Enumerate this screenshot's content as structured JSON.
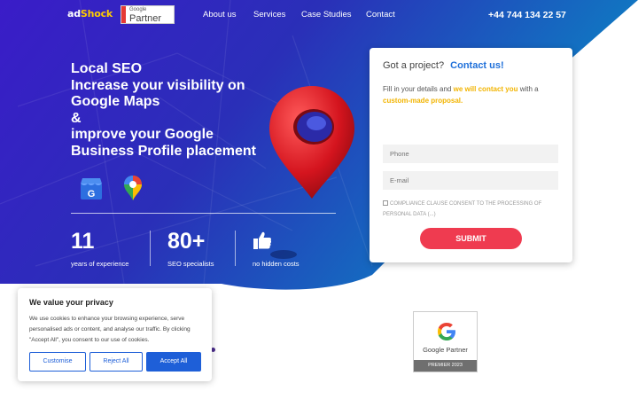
{
  "colors": {
    "hero_start": "#3a1cc8",
    "hero_end": "#0b7fc0",
    "accent_red": "#ef3b50",
    "accent_yellow": "#f2b400",
    "link_blue": "#1e6fd9",
    "cookie_blue": "#1e5fd8"
  },
  "header": {
    "logo_parts": {
      "a": "ad",
      "b": "Shock"
    },
    "partner_badge": {
      "google": "Google",
      "partner": "Partner"
    },
    "nav": [
      "About us",
      "Services",
      "Case Studies",
      "Contact"
    ],
    "phone": "+44 744 134 22 57"
  },
  "hero": {
    "title_lines": [
      "Local SEO",
      "Increase your visibility on",
      "Google Maps",
      "&",
      "improve your Google",
      "Business Profile placement"
    ],
    "icons": [
      "google-my-business-icon",
      "google-maps-pin-icon",
      "map-pin-3d-icon"
    ],
    "stats": [
      {
        "value": "11",
        "label": "years of experience"
      },
      {
        "value": "80+",
        "label": "SEO specialists"
      },
      {
        "icon": "thumbs-up-icon",
        "label": "no hidden costs"
      }
    ]
  },
  "form": {
    "heading": "Got a project?",
    "heading_link": "Contact us!",
    "sub_parts": [
      "Fill in your details and ",
      "we will contact you",
      " with a ",
      "custom-made proposal."
    ],
    "phone_placeholder": "Phone",
    "email_placeholder": "E-mail",
    "consent": "COMPLIANCE CLAUSE CONSENT TO THE PROCESSING OF PERSONAL DATA (...)",
    "submit": "SUBMIT"
  },
  "google_partner_badge": {
    "name": "Google Partner",
    "tier": "PREMIER 2023"
  },
  "cookie": {
    "title": "We value your privacy",
    "text": "We use cookies to enhance your browsing experience, serve personalised ads or content, and analyse our traffic. By clicking \"Accept All\", you consent to our use of cookies.",
    "customise": "Customise",
    "reject": "Reject All",
    "accept": "Accept All"
  }
}
